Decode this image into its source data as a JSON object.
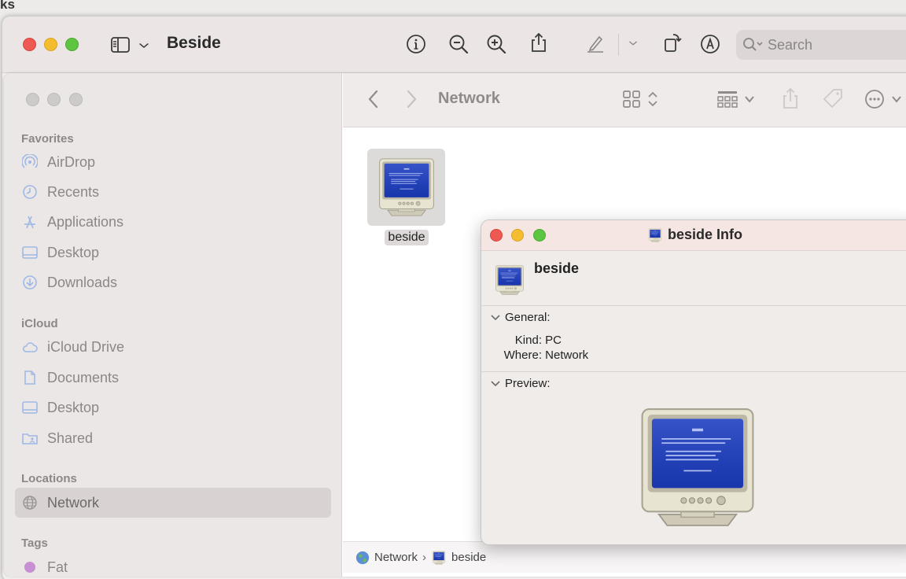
{
  "background": {
    "edge_text": "ks"
  },
  "preview": {
    "title": "Beside",
    "search_placeholder": "Search",
    "toolbar_icons": [
      "sidebar-toggle-icon",
      "chevron-down-icon",
      "info-icon",
      "zoom-out-icon",
      "zoom-in-icon",
      "share-icon",
      "markup-pen-icon",
      "chevron-down-icon",
      "rotate-icon",
      "annotate-icon",
      "search-icon"
    ]
  },
  "finder": {
    "title": "Network",
    "sidebar": {
      "favorites_label": "Favorites",
      "favorites": [
        {
          "label": "AirDrop",
          "icon": "airdrop-icon"
        },
        {
          "label": "Recents",
          "icon": "clock-icon"
        },
        {
          "label": "Applications",
          "icon": "applications-icon"
        },
        {
          "label": "Desktop",
          "icon": "desktop-icon"
        },
        {
          "label": "Downloads",
          "icon": "downloads-icon"
        }
      ],
      "icloud_label": "iCloud",
      "icloud": [
        {
          "label": "iCloud Drive",
          "icon": "cloud-icon"
        },
        {
          "label": "Documents",
          "icon": "document-icon"
        },
        {
          "label": "Desktop",
          "icon": "desktop-icon"
        },
        {
          "label": "Shared",
          "icon": "shared-folder-icon"
        }
      ],
      "locations_label": "Locations",
      "locations": [
        {
          "label": "Network",
          "icon": "globe-icon",
          "selected": true
        }
      ],
      "tags_label": "Tags",
      "tags": [
        {
          "label": "Fat",
          "color": "#c890d4"
        }
      ]
    },
    "file": {
      "name": "beside"
    },
    "pathbar": {
      "root": "Network",
      "leaf": "beside"
    }
  },
  "info_window": {
    "title": "beside Info",
    "name": "beside",
    "general_label": "General:",
    "kind_key": "Kind:",
    "kind_value": "PC",
    "where_key": "Where:",
    "where_value": "Network",
    "preview_label": "Preview:"
  },
  "colors": {
    "close": "#ee5a52",
    "minimize": "#f3bd2f",
    "zoom": "#5ec542",
    "selection": "#d8d3d2",
    "screen_blue": "#1b3cc0"
  }
}
